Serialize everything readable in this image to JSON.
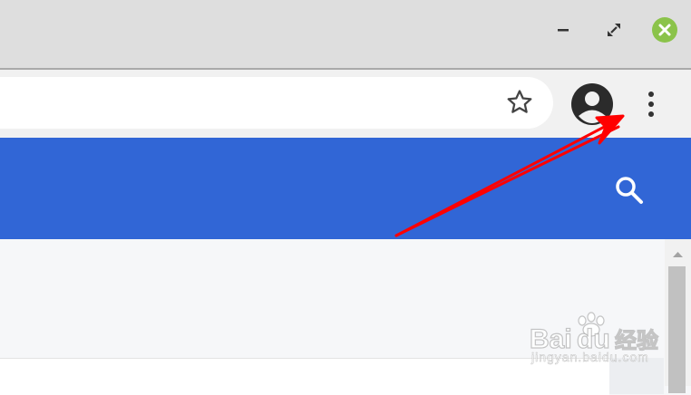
{
  "window": {
    "controls": [
      "minimize-icon",
      "restore-icon",
      "close-icon"
    ],
    "close_color": "#8bc34a"
  },
  "browser": {
    "omnibox_value": "",
    "bookmark_icon": "star-icon",
    "profile_icon": "account-circle-icon",
    "menu_icon": "more-vert-icon"
  },
  "site": {
    "header_color": "#3166d6",
    "search_icon": "search-icon"
  },
  "annotation": {
    "arrow_color": "#ff0000",
    "points_to": "more-vert-icon"
  },
  "watermark": {
    "logo": "Baidu经验",
    "subtext": "jingyan.baidu.com"
  }
}
